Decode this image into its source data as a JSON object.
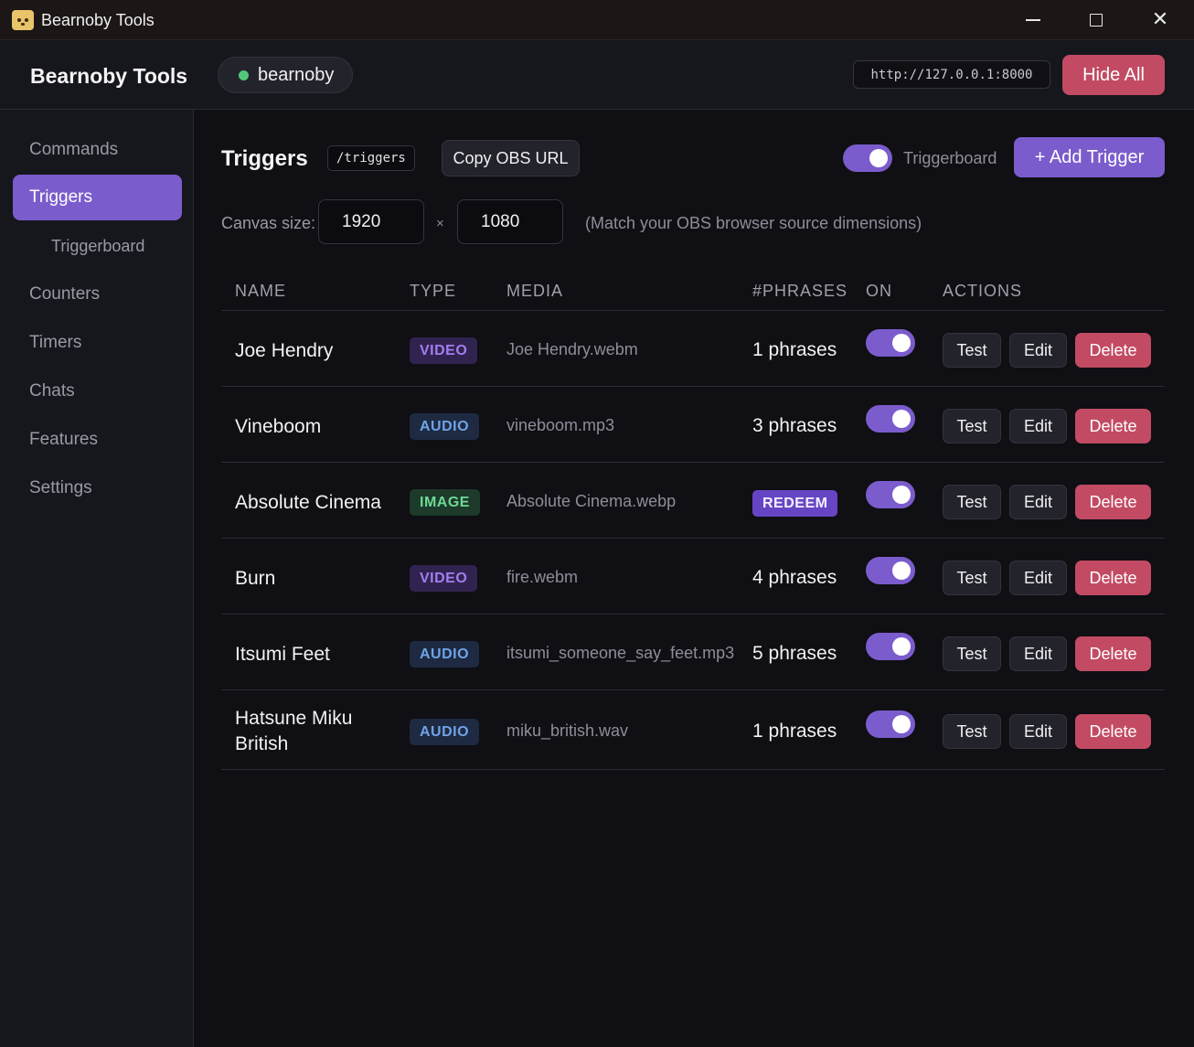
{
  "window": {
    "title": "Bearnoby Tools"
  },
  "header": {
    "brand": "Bearnoby Tools",
    "user": "bearnoby",
    "url": "http://127.0.0.1:8000",
    "hide_all_label": "Hide All",
    "status_color": "#52c77a"
  },
  "sidebar": {
    "items": [
      {
        "label": "Commands"
      },
      {
        "label": "Triggers"
      },
      {
        "label": "Triggerboard"
      },
      {
        "label": "Counters"
      },
      {
        "label": "Timers"
      },
      {
        "label": "Chats"
      },
      {
        "label": "Features"
      },
      {
        "label": "Settings"
      }
    ],
    "active": "Triggers"
  },
  "main": {
    "title": "Triggers",
    "path": "/triggers",
    "copy_label": "Copy OBS URL",
    "triggerboard_label": "Triggerboard",
    "triggerboard_on": true,
    "add_label": "+ Add Trigger",
    "canvas": {
      "label": "Canvas size:",
      "width": "1920",
      "height": "1080",
      "separator": "×",
      "hint": "(Match your OBS browser source dimensions)"
    }
  },
  "table": {
    "headers": {
      "name": "NAME",
      "type": "TYPE",
      "media": "MEDIA",
      "phrases": "#PHRASES",
      "on": "ON",
      "actions": "ACTIONS"
    },
    "rows": [
      {
        "name": "Joe Hendry",
        "type": "VIDEO",
        "media": "Joe Hendry.webm",
        "phrases": "1 phrases",
        "on": true
      },
      {
        "name": "Vineboom",
        "type": "AUDIO",
        "media": "vineboom.mp3",
        "phrases": "3 phrases",
        "on": true
      },
      {
        "name": "Absolute Cinema",
        "type": "IMAGE",
        "media": "Absolute Cinema.webp",
        "phrases": "REDEEM",
        "on": true
      },
      {
        "name": "Burn",
        "type": "VIDEO",
        "media": "fire.webm",
        "phrases": "4 phrases",
        "on": true
      },
      {
        "name": "Itsumi Feet",
        "type": "AUDIO",
        "media": "itsumi_someone_say_feet.mp3",
        "phrases": "5 phrases",
        "on": true
      },
      {
        "name": "Hatsune Miku British",
        "type": "AUDIO",
        "media": "miku_british.wav",
        "phrases": "1 phrases",
        "on": true
      }
    ],
    "actions": {
      "test": "Test",
      "edit": "Edit",
      "delete": "Delete"
    }
  },
  "colors": {
    "accent": "#7b5ccc",
    "danger": "#c24b63",
    "background": "#0f0f14",
    "panel": "#16161d"
  }
}
